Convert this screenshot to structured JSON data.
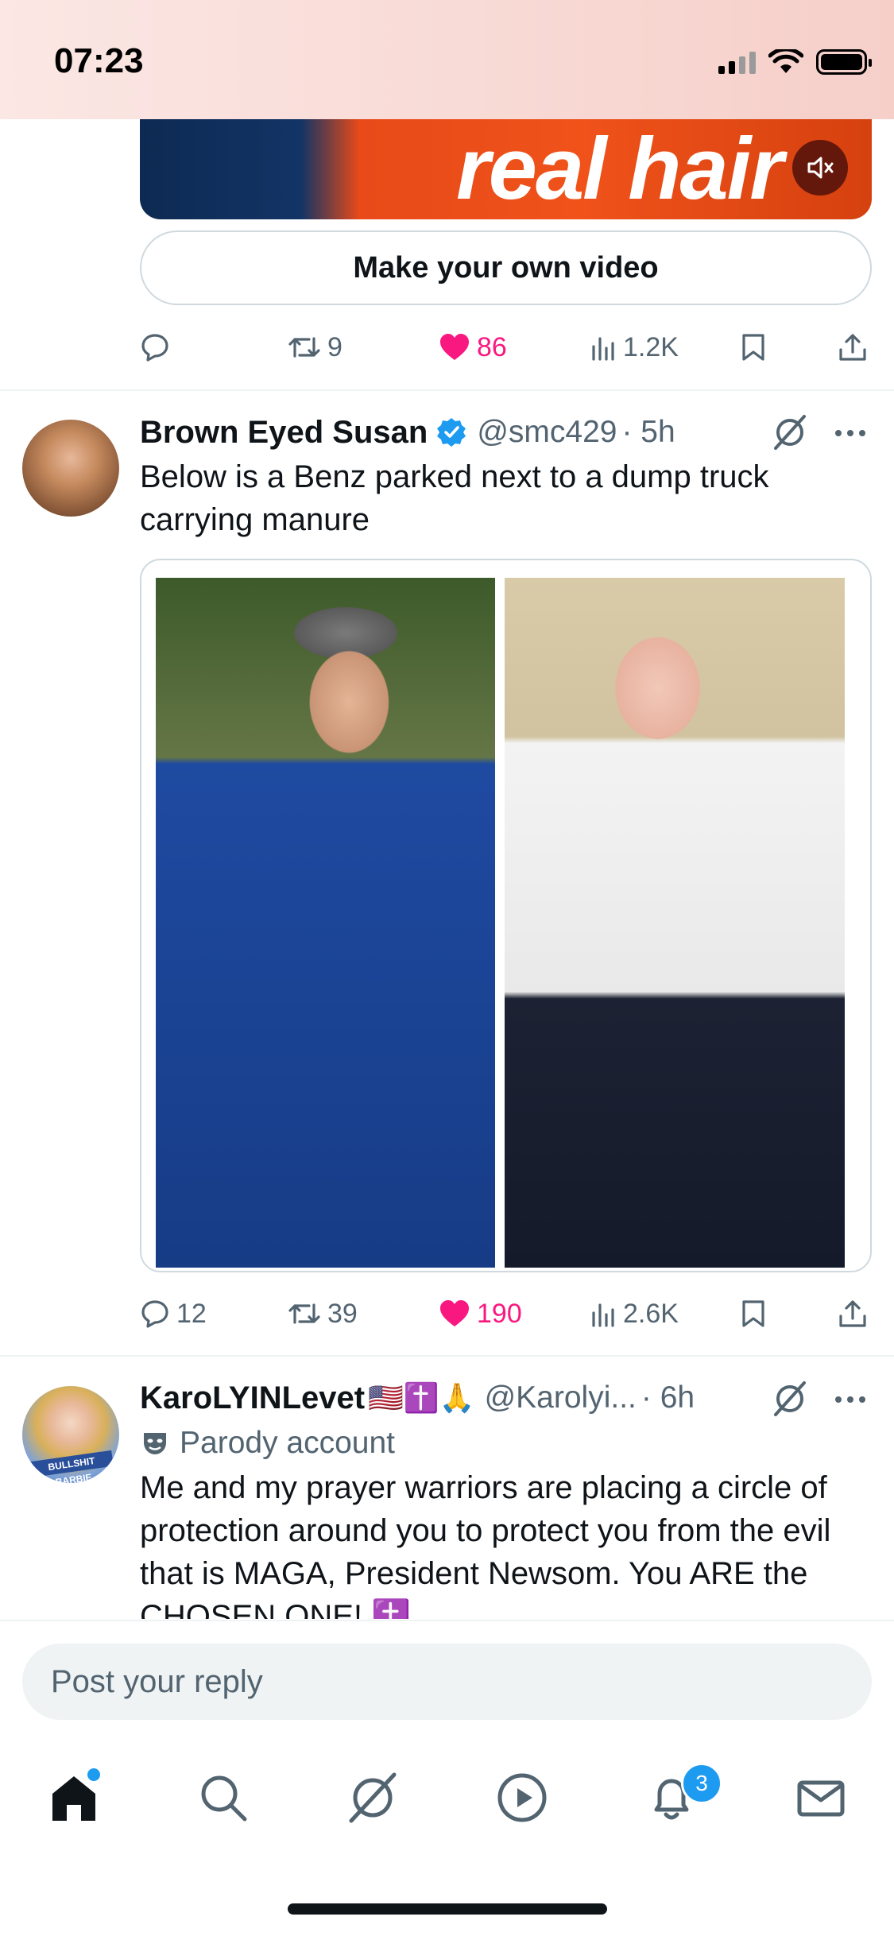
{
  "status_bar": {
    "time": "07:23"
  },
  "top_post": {
    "video_caption": "real hair",
    "make_video_label": "Make your own video",
    "actions": {
      "replies": "",
      "reposts": "9",
      "likes": "86",
      "views": "1.2K"
    }
  },
  "post1": {
    "display_name": "Brown Eyed Susan",
    "handle": "@smc429",
    "time": "· 5h",
    "text": "Below is a Benz parked next to a dump truck carrying manure",
    "actions": {
      "replies": "12",
      "reposts": "39",
      "likes": "190",
      "views": "2.6K"
    }
  },
  "post2": {
    "display_name": "KaroLYINLevet",
    "name_emojis": "🇺🇸✝️🙏",
    "handle": "@Karolyi...",
    "time": "· 6h",
    "parody_label": "Parody account",
    "avatar_ribbon": "BULLSHIT BARBIE",
    "text": "Me and my prayer warriors are placing a circle of protection around you to protect you from the evil that is MAGA, President Newsom. You ARE the CHOSEN ONE! ✝️"
  },
  "reply": {
    "placeholder": "Post your reply"
  },
  "tabbar": {
    "notifications_count": "3"
  },
  "colors": {
    "like": "#f91880",
    "accent": "#1d9bf0",
    "secondary_text": "#536471"
  }
}
